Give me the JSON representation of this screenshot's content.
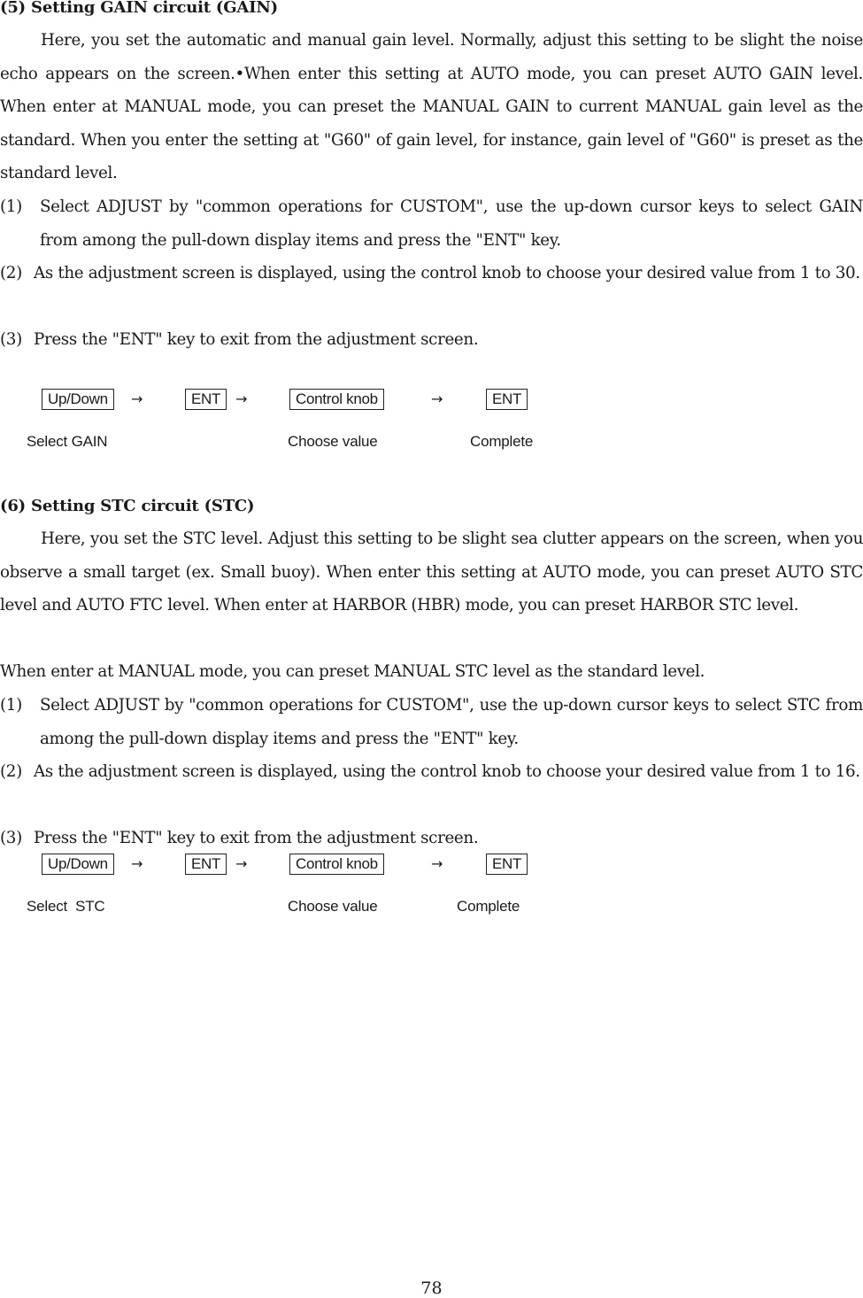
{
  "page_number": "78",
  "sections": [
    {
      "heading": "(5) Setting GAIN circuit (GAIN)",
      "intro": "Here, you set the automatic and manual gain level. Normally, adjust this setting to be slight the noise echo appears on the screen.•When enter this setting at AUTO mode, you can preset AUTO GAIN level. When enter at MANUAL mode, you can preset the MANUAL GAIN to current MANUAL gain level as the standard. When you enter the setting at \"G60\" of gain level, for instance, gain level of \"G60\" is preset as the standard level.",
      "steps": [
        {
          "num": "(1)",
          "text": "Select ADJUST by \"common operations for CUSTOM\", use the up-down cursor keys to select  GAIN from among the pull-down display items and press the \"ENT\" key."
        },
        {
          "num": "(2)",
          "text": "As the adjustment screen is displayed, using the control knob to choose your desired value from 1 to 30."
        },
        {
          "num": "(3)",
          "text": "Press the \"ENT\" key to exit from the adjustment screen."
        }
      ],
      "flow": {
        "keys": [
          "Up/Down",
          "ENT",
          "Control knob",
          "ENT"
        ],
        "arrow": "→",
        "labels": [
          "Select GAIN",
          "Choose value",
          "Complete"
        ]
      }
    },
    {
      "heading": "(6) Setting STC circuit (STC)",
      "intro": "Here, you set the STC level. Adjust this setting to be slight sea clutter appears on the screen, when you observe a small target (ex. Small buoy). When enter this setting at AUTO mode, you can preset AUTO STC level and AUTO FTC level. When enter at HARBOR (HBR) mode, you can preset HARBOR STC level.",
      "intro2": "When enter at MANUAL mode, you can preset MANUAL STC level as the standard level.",
      "steps": [
        {
          "num": "(1)",
          "text": "Select ADJUST by \"common operations for CUSTOM\", use the up-down cursor keys to select  STC from among the pull-down display items and press the \"ENT\" key."
        },
        {
          "num": "(2)",
          "text": "As the adjustment screen is displayed, using the control knob to choose your desired value from 1 to 16."
        },
        {
          "num": "(3)",
          "text": "Press the \"ENT\" key to exit from the adjustment screen."
        }
      ],
      "flow": {
        "keys": [
          "Up/Down",
          "ENT",
          "Control knob",
          "ENT"
        ],
        "arrow": "→",
        "labels": [
          "Select  STC",
          "Choose value",
          "Complete"
        ]
      }
    }
  ]
}
